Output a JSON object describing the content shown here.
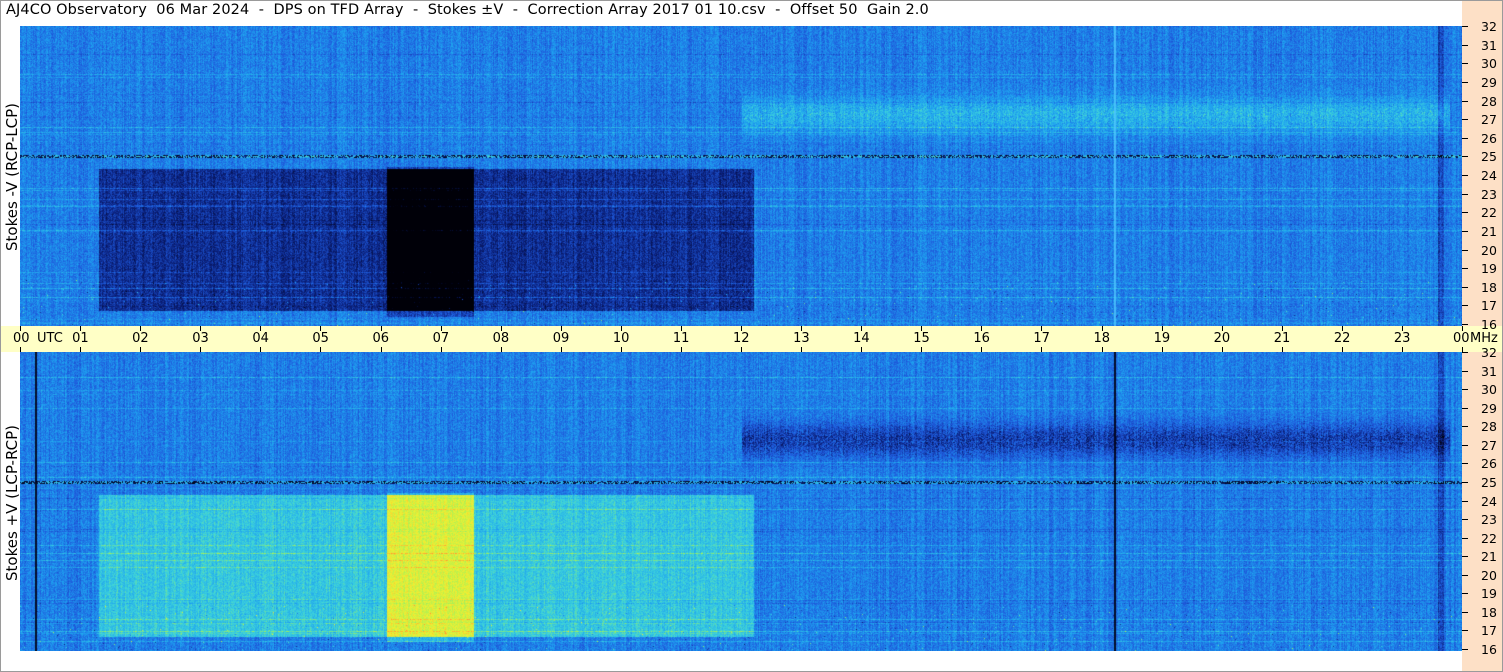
{
  "title": "AJ4CO Observatory  06 Mar 2024  -  DPS on TFD Array  -  Stokes ±V  -  Correction Array 2017 01 10.csv  -  Offset 50  Gain 2.0",
  "chart_data": {
    "type": "heatmap",
    "panels": [
      {
        "label": "Stokes -V (RCP-LCP)",
        "polarity": "RCP-LCP"
      },
      {
        "label": "Stokes +V (LCP-RCP)",
        "polarity": "LCP-RCP"
      }
    ],
    "x_axis": {
      "unit_label": "UTC",
      "ticks": [
        "00",
        "01",
        "02",
        "03",
        "04",
        "05",
        "06",
        "07",
        "08",
        "09",
        "10",
        "11",
        "12",
        "13",
        "14",
        "15",
        "16",
        "17",
        "18",
        "19",
        "20",
        "21",
        "22",
        "23",
        "00"
      ],
      "range_hours": [
        0,
        24
      ]
    },
    "y_axis": {
      "unit_label": "MHz",
      "ticks": [
        "32",
        "31",
        "30",
        "29",
        "28",
        "27",
        "26",
        "25",
        "24",
        "23",
        "22",
        "21",
        "20",
        "19",
        "18",
        "17",
        "16"
      ],
      "range_mhz": [
        16,
        32
      ]
    },
    "colormap": [
      "#000008",
      "#0a1e78",
      "#1e5adc",
      "#1ea0f0",
      "#3cd2dc",
      "#a0f05a",
      "#f0f032",
      "#ff9632"
    ]
  },
  "colors": {
    "axis_band": "#ffffc6",
    "right_strip": "#fde0c6"
  }
}
